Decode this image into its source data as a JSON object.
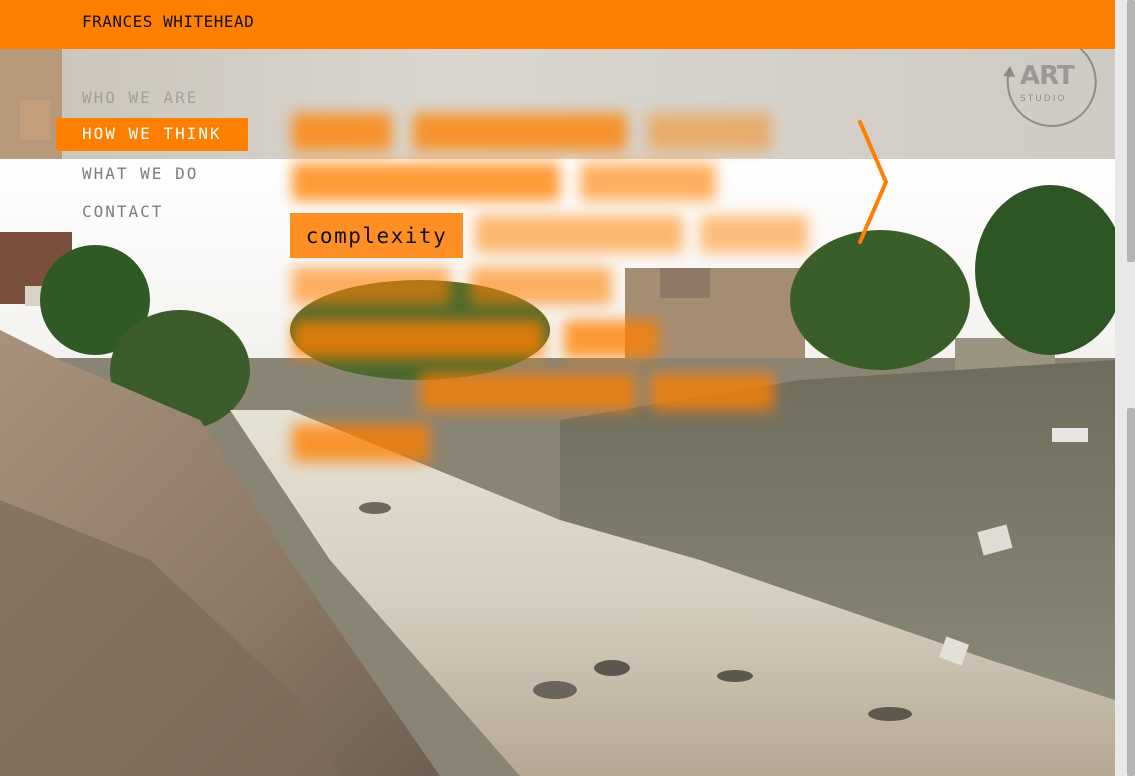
{
  "header": {
    "site_title": "FRANCES WHITEHEAD"
  },
  "nav": {
    "items": [
      {
        "label": "WHO WE ARE",
        "state": "faded"
      },
      {
        "label": "HOW WE THINK",
        "state": "active"
      },
      {
        "label": "WHAT WE DO",
        "state": "normal"
      },
      {
        "label": "CONTACT",
        "state": "normal"
      }
    ]
  },
  "tags": {
    "focused_label": "complexity"
  },
  "logo": {
    "mark": "ART",
    "subtitle": "STUDIO"
  },
  "icons": {
    "next": "chevron-right-icon",
    "logo": "art-studio-logo-icon"
  },
  "colors": {
    "accent": "#ff8000",
    "nav_text": "#7d7d7d",
    "active_text": "#ffffff"
  }
}
